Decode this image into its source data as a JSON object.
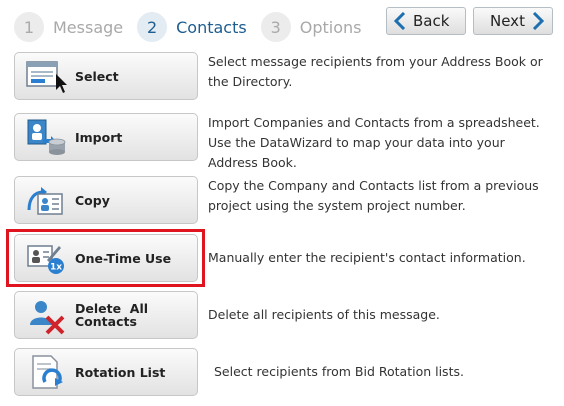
{
  "wizard": {
    "steps": [
      {
        "number": "1",
        "label": "Message"
      },
      {
        "number": "2",
        "label": "Contacts"
      },
      {
        "number": "3",
        "label": "Options"
      }
    ],
    "active_step": "Contacts",
    "back_label": "Back",
    "next_label": "Next"
  },
  "options": [
    {
      "button": "Select",
      "icon": "address-book-select-icon",
      "description": "Select message recipients from your Address Book or the Directory."
    },
    {
      "button": "Import",
      "icon": "import-database-icon",
      "description": "Import Companies and Contacts from a spreadsheet. Use the DataWizard to map your data into your Address Book."
    },
    {
      "button": "Copy",
      "icon": "copy-contacts-icon",
      "description": "Copy the Company and Contacts list from a previous project using the system project number."
    },
    {
      "button": "One-Time Use",
      "icon": "one-time-contact-icon",
      "description": "Manually enter the recipient's contact information."
    },
    {
      "button": "Delete  All Contacts",
      "icon": "delete-contacts-icon",
      "description": "Delete all recipients of this message."
    },
    {
      "button": "Rotation List",
      "icon": "rotation-list-icon",
      "description": "Select recipients from Bid Rotation lists."
    }
  ],
  "colors": {
    "accent": "#1d5d8f",
    "highlight": "#e0141e"
  }
}
